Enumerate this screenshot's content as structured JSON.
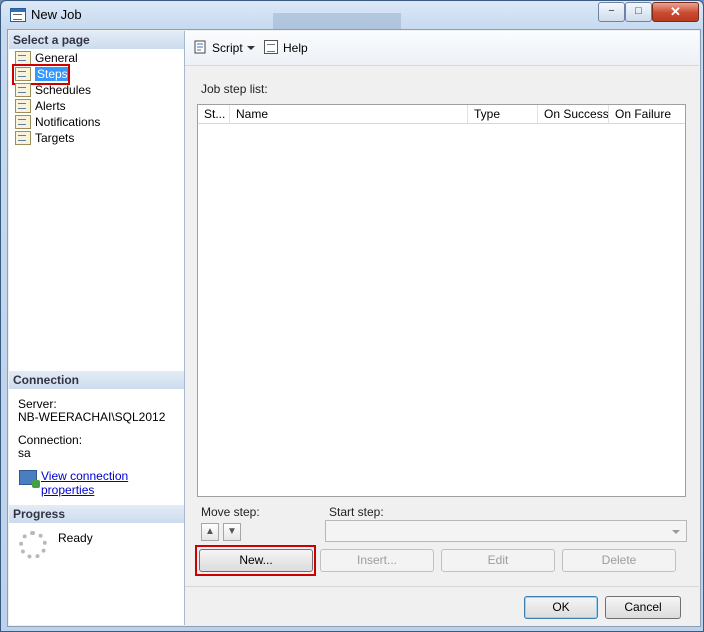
{
  "window": {
    "title": "New Job",
    "controls": {
      "minimize": "−",
      "maximize": "□",
      "close": "✕"
    }
  },
  "left": {
    "select_header": "Select a page",
    "pages": [
      "General",
      "Steps",
      "Schedules",
      "Alerts",
      "Notifications",
      "Targets"
    ],
    "selected_page": "Steps",
    "connection_header": "Connection",
    "server_label": "Server:",
    "server_value": "NB-WEERACHAI\\SQL2012",
    "connection_label": "Connection:",
    "connection_value": "sa",
    "view_link": "View connection properties",
    "progress_header": "Progress",
    "progress_status": "Ready"
  },
  "toolbar": {
    "script_label": "Script",
    "help_label": "Help"
  },
  "main": {
    "list_label": "Job step list:",
    "columns": [
      "St...",
      "Name",
      "Type",
      "On Success",
      "On Failure"
    ],
    "move_step_label": "Move step:",
    "start_step_label": "Start step:",
    "start_step_value": "",
    "buttons": {
      "new": "New...",
      "insert": "Insert...",
      "edit": "Edit",
      "delete": "Delete"
    }
  },
  "footer": {
    "ok": "OK",
    "cancel": "Cancel"
  },
  "icons": {
    "up": "▲",
    "down": "▼"
  }
}
